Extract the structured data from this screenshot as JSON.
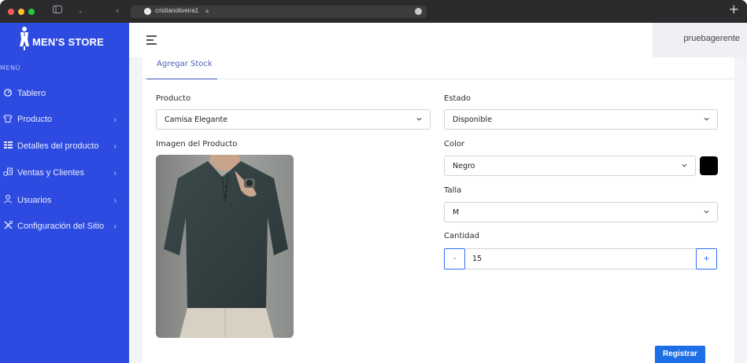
{
  "browser": {
    "url_text": "cristianoliveira1"
  },
  "sidebar": {
    "brand": "MEN'S STORE",
    "menu_heading": "MENÚ",
    "items": [
      {
        "label": "Tablero",
        "icon": "dashboard-icon",
        "has_chevron": false
      },
      {
        "label": "Producto",
        "icon": "shirt-icon",
        "has_chevron": true
      },
      {
        "label": "Detalles del producto",
        "icon": "details-icon",
        "has_chevron": true
      },
      {
        "label": "Ventas y Clientes",
        "icon": "sales-icon",
        "has_chevron": true
      },
      {
        "label": "Usuarios",
        "icon": "user-icon",
        "has_chevron": true
      },
      {
        "label": "Configuración del Sitio",
        "icon": "tools-icon",
        "has_chevron": true
      }
    ]
  },
  "header": {
    "username": "pruebagerente"
  },
  "tabs": {
    "active": "Agregar Stock"
  },
  "form": {
    "producto": {
      "label": "Producto",
      "value": "Camisa Elegante"
    },
    "imagen": {
      "label": "Imagen del Producto"
    },
    "estado": {
      "label": "Estado",
      "value": "Disponible"
    },
    "color": {
      "label": "Color",
      "value": "Negro",
      "swatch": "#000000"
    },
    "talla": {
      "label": "Talla",
      "value": "M"
    },
    "cantidad": {
      "label": "Cantidad",
      "value": "15",
      "minus": "-",
      "plus": "+"
    },
    "submit": "Registrar"
  },
  "colors": {
    "sidebar": "#2d4be0",
    "accent": "#1e6fe6"
  }
}
